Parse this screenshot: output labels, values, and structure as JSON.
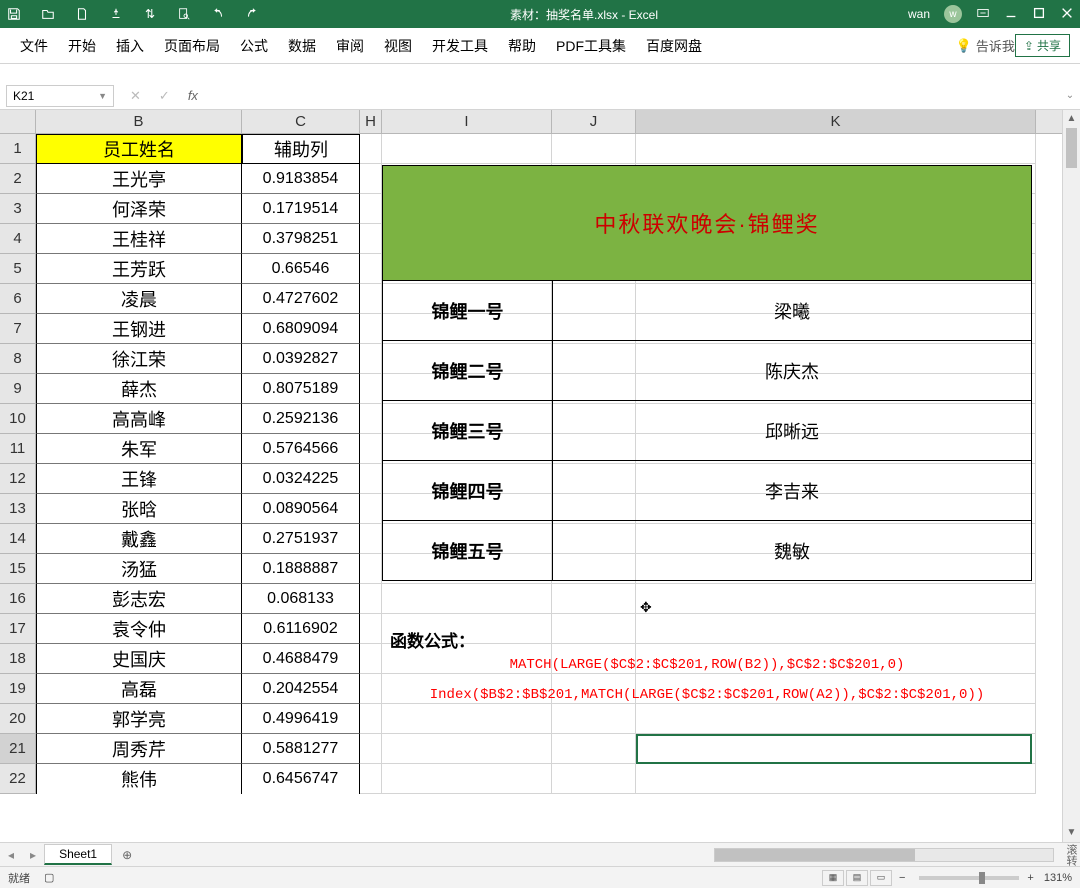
{
  "titlebar": {
    "doc_title": "素材：抽奖名单.xlsx - Excel",
    "user": "wan",
    "user_initial": "w"
  },
  "ribbon": {
    "tabs": [
      "文件",
      "开始",
      "插入",
      "页面布局",
      "公式",
      "数据",
      "审阅",
      "视图",
      "开发工具",
      "帮助",
      "PDF工具集",
      "百度网盘"
    ],
    "tellme": "告诉我",
    "share": "共享"
  },
  "namebox": "K21",
  "formula": "",
  "columns": [
    "B",
    "C",
    "H",
    "I",
    "J",
    "K"
  ],
  "rows": {
    "headers": [
      "1",
      "2",
      "3",
      "4",
      "5",
      "6",
      "7",
      "8",
      "9",
      "10",
      "11",
      "12",
      "13",
      "14",
      "15",
      "16",
      "17",
      "18",
      "19",
      "20",
      "21",
      "22"
    ],
    "b_header": "员工姓名",
    "c_header": "辅助列",
    "names": [
      "王光亭",
      "何泽荣",
      "王桂祥",
      "王芳跃",
      "凌晨",
      "王钢进",
      "徐江荣",
      "薛杰",
      "高高峰",
      "朱军",
      "王锋",
      "张晗",
      "戴鑫",
      "汤猛",
      "彭志宏",
      "袁令仲",
      "史国庆",
      "高磊",
      "郭学亮",
      "周秀芹",
      "熊伟"
    ],
    "helper": [
      "0.9183854",
      "0.1719514",
      "0.3798251",
      "0.66546",
      "0.4727602",
      "0.6809094",
      "0.0392827",
      "0.8075189",
      "0.2592136",
      "0.5764566",
      "0.0324225",
      "0.0890564",
      "0.2751937",
      "0.1888887",
      "0.068133",
      "0.6116902",
      "0.4688479",
      "0.2042554",
      "0.4996419",
      "0.5881277",
      "0.6456747"
    ]
  },
  "banner": "中秋联欢晚会·锦鲤奖",
  "prizes": [
    {
      "label": "锦鲤一号",
      "winner": "梁曦"
    },
    {
      "label": "锦鲤二号",
      "winner": "陈庆杰"
    },
    {
      "label": "锦鲤三号",
      "winner": "邱晰远"
    },
    {
      "label": "锦鲤四号",
      "winner": "李吉来"
    },
    {
      "label": "锦鲤五号",
      "winner": "魏敏"
    }
  ],
  "func_label": "函数公式：",
  "formula1": "MATCH(LARGE($C$2:$C$201,ROW(B2)),$C$2:$C$201,0)",
  "formula2": "Index($B$2:$B$201,MATCH(LARGE($C$2:$C$201,ROW(A2)),$C$2:$C$201,0))",
  "sheet_tab": "Sheet1",
  "status": {
    "ready": "就绪",
    "zoom": "131%",
    "rt": "滚转"
  }
}
